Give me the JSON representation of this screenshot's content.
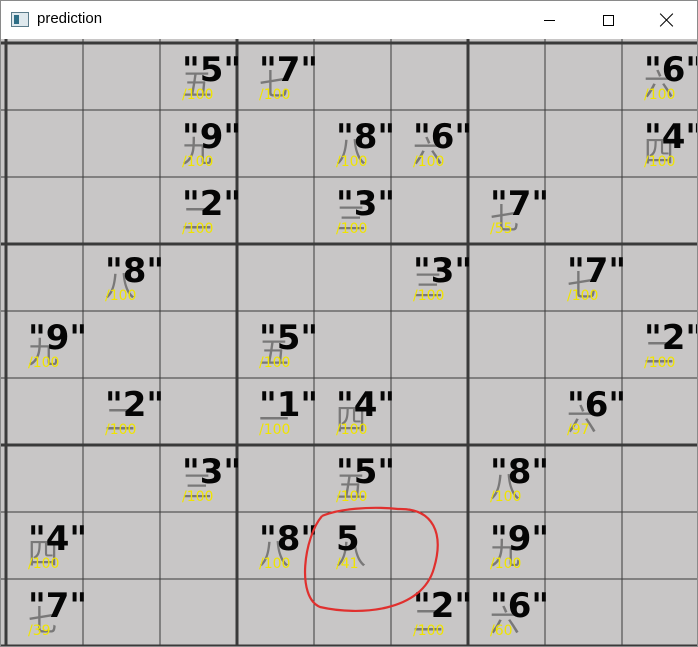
{
  "window": {
    "title": "prediction",
    "controls": {
      "minimize": "minimize-icon",
      "maximize": "maximize-icon",
      "close": "close-icon"
    }
  },
  "board": {
    "colors": {
      "paper": "#c8c6c6",
      "grid": "#3a3a3a",
      "prediction": "#050505",
      "confidence": "#f0e400",
      "highlight": "#e0302e"
    },
    "cells": [
      {
        "row": 0,
        "col": 2,
        "label": "\"5\"",
        "conf": "/100",
        "hand": "五"
      },
      {
        "row": 0,
        "col": 3,
        "label": "\"7\"",
        "conf": "/100",
        "hand": "七"
      },
      {
        "row": 0,
        "col": 8,
        "label": "\"6\"",
        "conf": "/100",
        "hand": "六"
      },
      {
        "row": 1,
        "col": 2,
        "label": "\"9\"",
        "conf": "/100",
        "hand": "九"
      },
      {
        "row": 1,
        "col": 4,
        "label": "\"8\"",
        "conf": "/100",
        "hand": "八"
      },
      {
        "row": 1,
        "col": 5,
        "label": "\"6\"",
        "conf": "/100",
        "hand": "六"
      },
      {
        "row": 1,
        "col": 8,
        "label": "\"4\"",
        "conf": "/100",
        "hand": "四"
      },
      {
        "row": 2,
        "col": 2,
        "label": "\"2\"",
        "conf": "/100",
        "hand": "二"
      },
      {
        "row": 2,
        "col": 4,
        "label": "\"3\"",
        "conf": "/100",
        "hand": "三"
      },
      {
        "row": 2,
        "col": 6,
        "label": "\"7\"",
        "conf": "/55",
        "hand": "七"
      },
      {
        "row": 3,
        "col": 1,
        "label": "\"8\"",
        "conf": "/100",
        "hand": "八"
      },
      {
        "row": 3,
        "col": 5,
        "label": "\"3\"",
        "conf": "/100",
        "hand": "三"
      },
      {
        "row": 3,
        "col": 7,
        "label": "\"7\"",
        "conf": "/100",
        "hand": "七"
      },
      {
        "row": 4,
        "col": 0,
        "label": "\"9\"",
        "conf": "/100",
        "hand": "九"
      },
      {
        "row": 4,
        "col": 3,
        "label": "\"5\"",
        "conf": "/100",
        "hand": "五"
      },
      {
        "row": 4,
        "col": 8,
        "label": "\"2\"",
        "conf": "/100",
        "hand": "二"
      },
      {
        "row": 5,
        "col": 1,
        "label": "\"2\"",
        "conf": "/100",
        "hand": "二"
      },
      {
        "row": 5,
        "col": 3,
        "label": "\"1\"",
        "conf": "/100",
        "hand": "一"
      },
      {
        "row": 5,
        "col": 4,
        "label": "\"4\"",
        "conf": "/100",
        "hand": "四"
      },
      {
        "row": 5,
        "col": 7,
        "label": "\"6\"",
        "conf": "/97",
        "hand": "六"
      },
      {
        "row": 6,
        "col": 2,
        "label": "\"3\"",
        "conf": "/100",
        "hand": "三"
      },
      {
        "row": 6,
        "col": 4,
        "label": "\"5\"",
        "conf": "/100",
        "hand": "五"
      },
      {
        "row": 6,
        "col": 6,
        "label": "\"8\"",
        "conf": "/100",
        "hand": "八"
      },
      {
        "row": 7,
        "col": 0,
        "label": "\"4\"",
        "conf": "/100",
        "hand": "四"
      },
      {
        "row": 7,
        "col": 3,
        "label": "\"8\"",
        "conf": "/100",
        "hand": "八"
      },
      {
        "row": 7,
        "col": 4,
        "label": "5",
        "conf": "/41",
        "hand": "八"
      },
      {
        "row": 7,
        "col": 6,
        "label": "\"9\"",
        "conf": "/100",
        "hand": "九"
      },
      {
        "row": 8,
        "col": 0,
        "label": "\"7\"",
        "conf": "/39",
        "hand": "七"
      },
      {
        "row": 8,
        "col": 5,
        "label": "\"2\"",
        "conf": "/100",
        "hand": "二"
      },
      {
        "row": 8,
        "col": 6,
        "label": "\"6\"",
        "conf": "/60",
        "hand": "六"
      }
    ]
  }
}
